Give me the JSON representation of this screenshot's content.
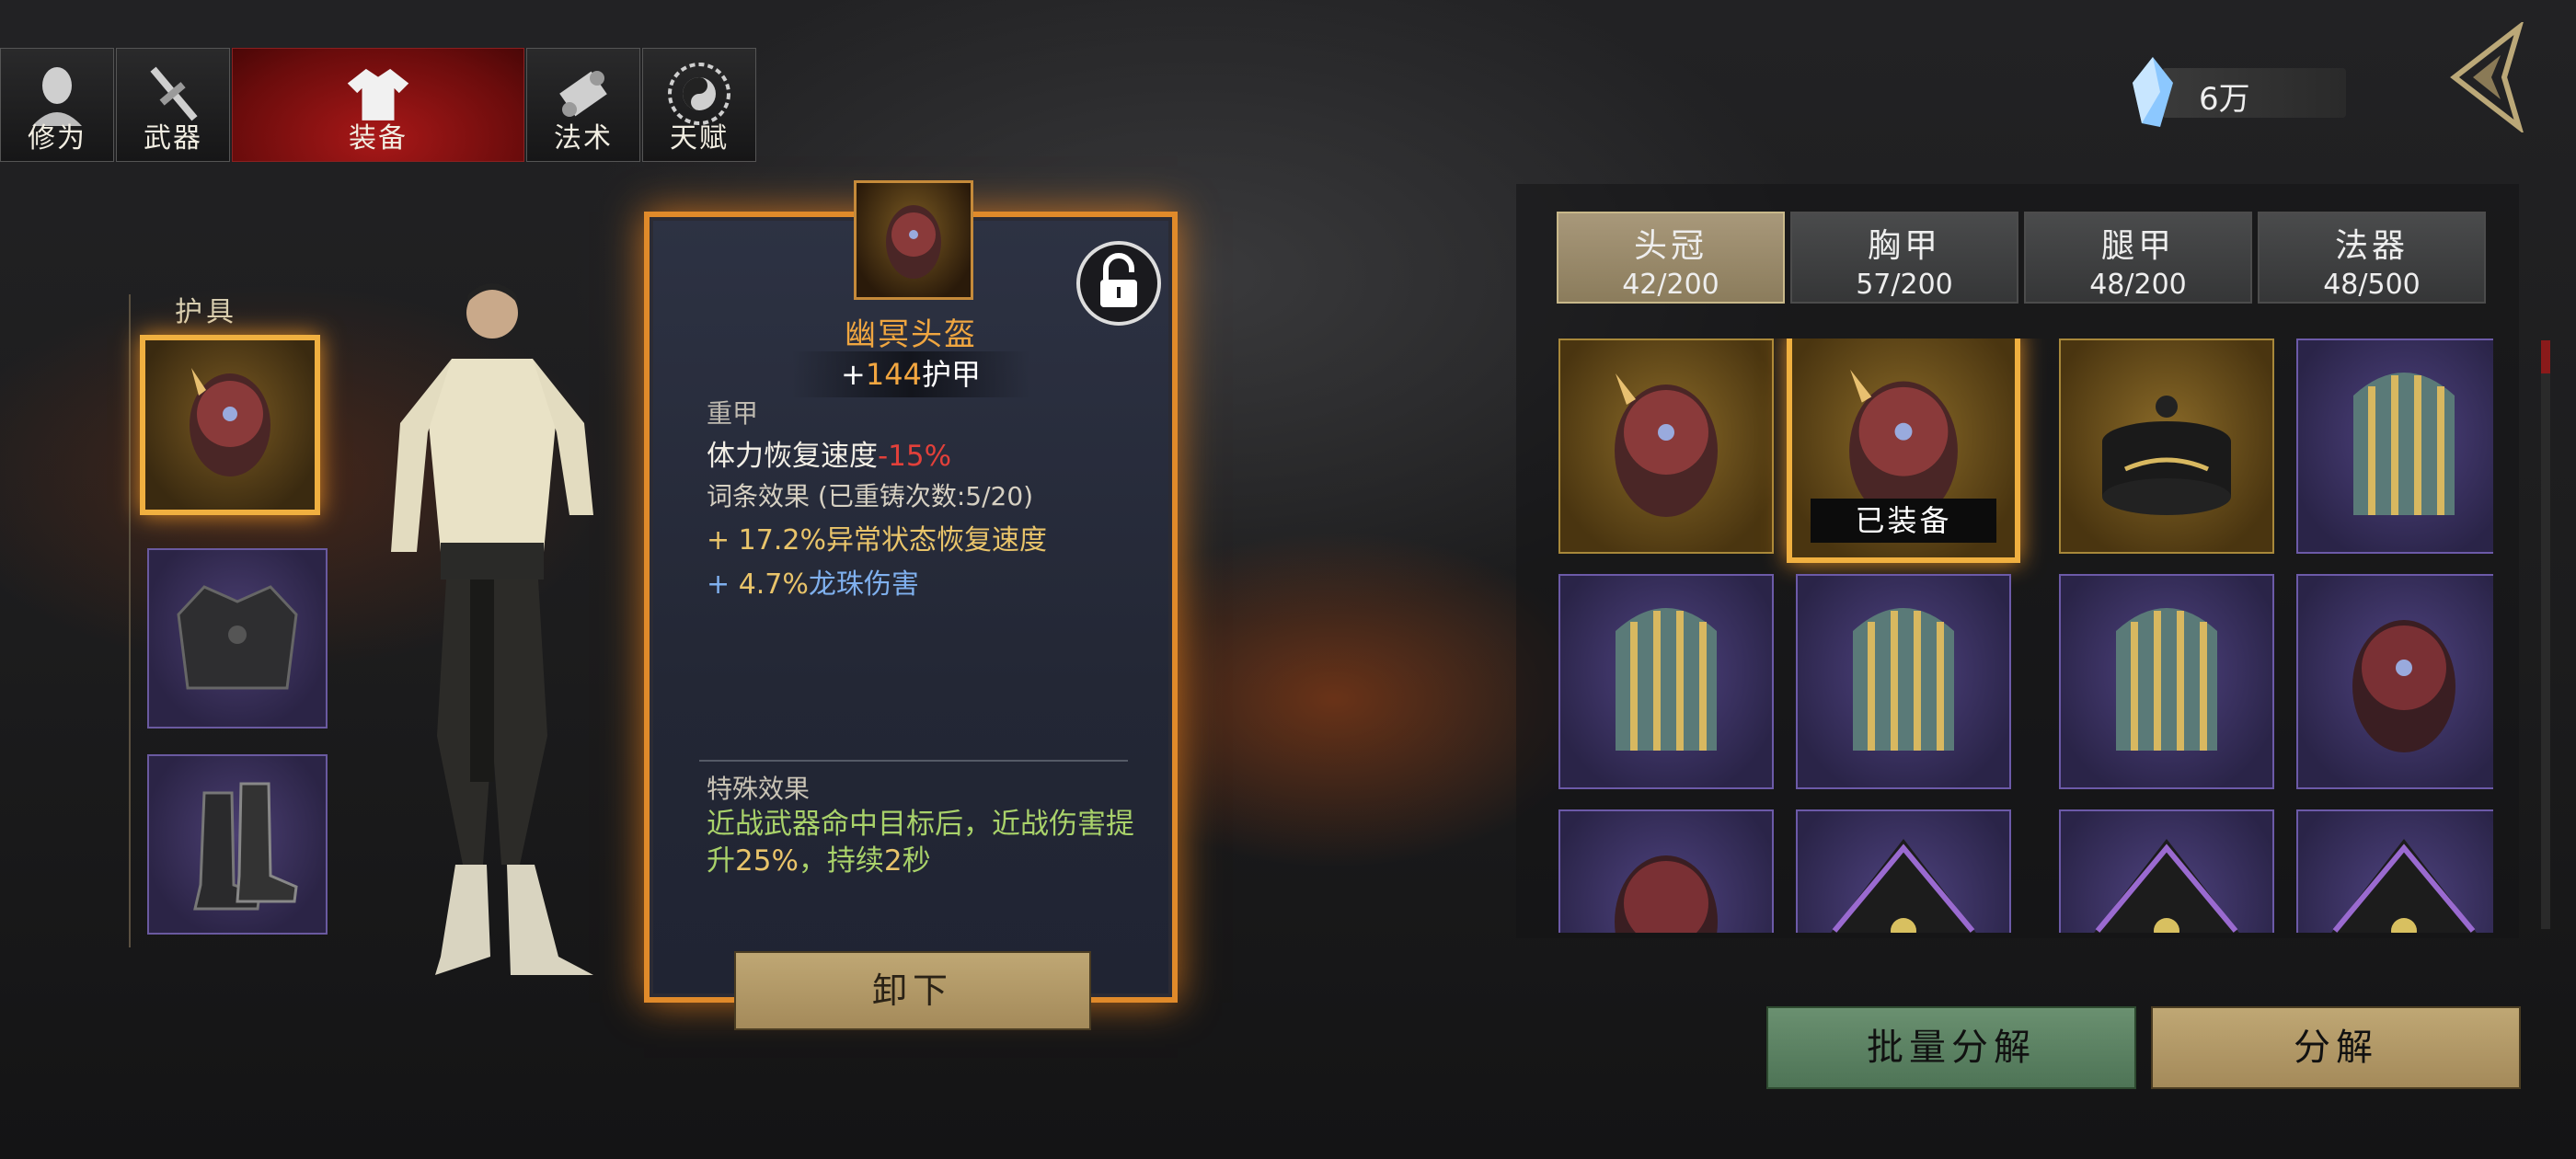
{
  "tabs": [
    {
      "label": "修为",
      "icon": "cultivation-head-icon",
      "active": false
    },
    {
      "label": "武器",
      "icon": "weapon-icon",
      "active": false
    },
    {
      "label": "装备",
      "icon": "robe-icon",
      "active": true
    },
    {
      "label": "法术",
      "icon": "scroll-icon",
      "active": false
    },
    {
      "label": "天赋",
      "icon": "taiji-icon",
      "active": false
    }
  ],
  "currency": {
    "value": "6万",
    "icon": "crystal-icon"
  },
  "armor_slots": {
    "title": "护具"
  },
  "tooltip": {
    "name": "幽冥头盔",
    "armor_prefix": "+",
    "armor_value": "144",
    "armor_label": "护甲",
    "type": "重甲",
    "stat_label": "体力恢复速度",
    "stat_value": "-15%",
    "affix_title": "词条效果  (已重铸次数:5/20)",
    "affix1": "+ 17.2%异常状态恢复速度",
    "affix2_prefix": "+ ",
    "affix2_value": "4.7%",
    "affix2_label": "龙珠伤害",
    "special_title": "特殊效果",
    "special_a": "近战武器命中目标后，近战伤害提升",
    "special_pct": "25%",
    "special_b": "，持续",
    "special_sec": "2",
    "special_c": "秒",
    "unequip_label": "卸下"
  },
  "categories": [
    {
      "name": "头冠",
      "count": "42/200",
      "active": true
    },
    {
      "name": "胸甲",
      "count": "57/200",
      "active": false
    },
    {
      "name": "腿甲",
      "count": "48/200",
      "active": false
    },
    {
      "name": "法器",
      "count": "48/500",
      "active": false
    }
  ],
  "inventory": {
    "equipped_tag": "已装备",
    "items": [
      {
        "icon": "demon-helmet-icon",
        "rarity": "gold"
      },
      {
        "icon": "demon-helmet-icon",
        "rarity": "gold",
        "equipped": true
      },
      {
        "icon": "black-hat-icon",
        "rarity": "gold"
      },
      {
        "icon": "striped-helmet-icon",
        "rarity": "purple"
      },
      {
        "icon": "striped-helmet-icon",
        "rarity": "purple"
      },
      {
        "icon": "striped-helmet-icon",
        "rarity": "purple"
      },
      {
        "icon": "striped-helmet-icon",
        "rarity": "purple"
      },
      {
        "icon": "demon-helmet-icon",
        "rarity": "purple"
      },
      {
        "icon": "demon-helmet-icon",
        "rarity": "purple"
      },
      {
        "icon": "cloth-hood-icon",
        "rarity": "purple"
      },
      {
        "icon": "cloth-hood-icon",
        "rarity": "purple"
      },
      {
        "icon": "cloth-hood-icon",
        "rarity": "purple"
      }
    ]
  },
  "buttons": {
    "batch": "批量分解",
    "dismantle": "分解"
  },
  "colors": {
    "accent_orange": "#f0a640",
    "tab_active": "#a81818",
    "stat_negative": "#e2403a",
    "special_green": "#a9d26a"
  }
}
